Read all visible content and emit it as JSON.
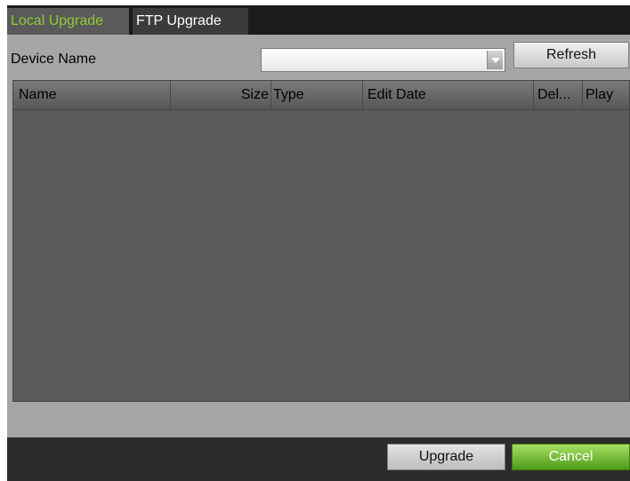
{
  "tabs": [
    {
      "label": "Local Upgrade",
      "active": true
    },
    {
      "label": "FTP Upgrade",
      "active": false
    }
  ],
  "device": {
    "label": "Device Name",
    "selected_value": "",
    "refresh_label": "Refresh"
  },
  "table": {
    "columns": [
      "Name",
      "Size",
      "Type",
      "Edit Date",
      "Del...",
      "Play"
    ],
    "rows": []
  },
  "footer": {
    "upgrade_label": "Upgrade",
    "cancel_label": "Cancel"
  },
  "colors": {
    "active_tab_text": "#8fcd2e",
    "cancel_button": "#6cbf2a"
  }
}
